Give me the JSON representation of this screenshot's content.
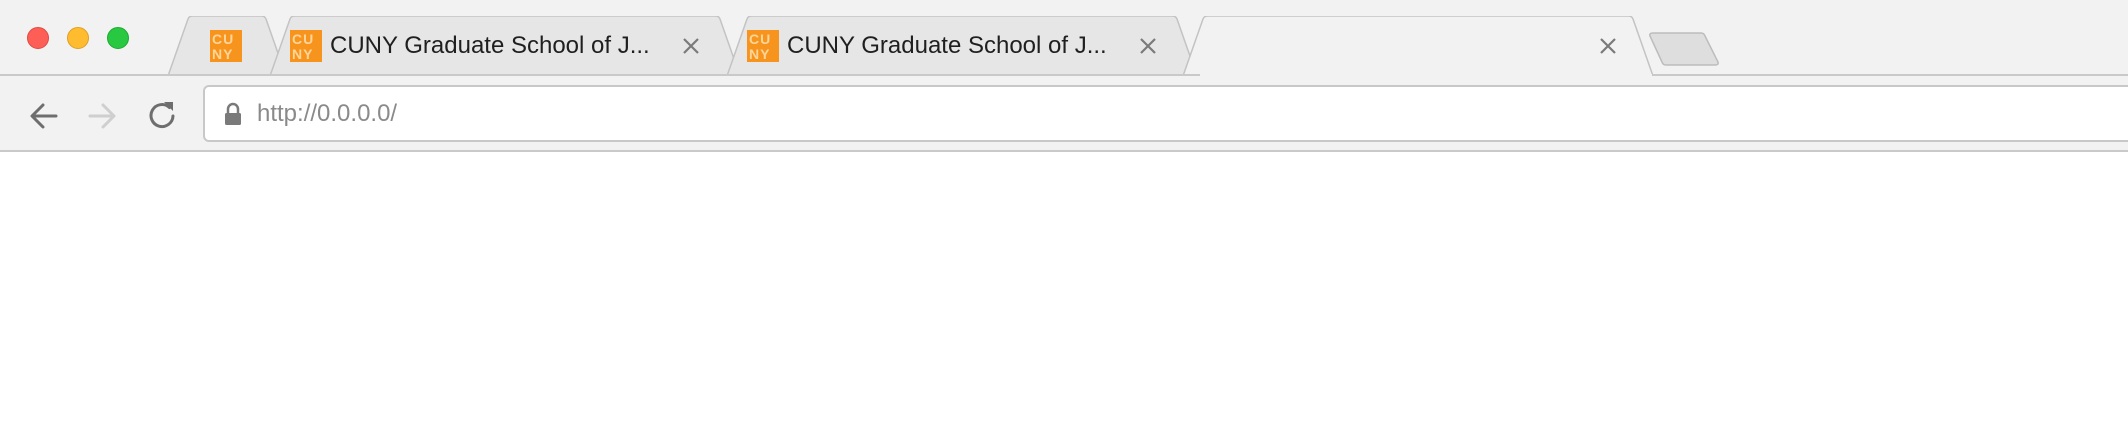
{
  "window": {
    "controls": [
      "close",
      "minimize",
      "maximize"
    ]
  },
  "tabs": [
    {
      "favicon": "cuny-logo",
      "favicon_text": "CUNY",
      "title": "",
      "pinned": true,
      "active": false
    },
    {
      "favicon": "cuny-logo",
      "favicon_text": "CUNY",
      "title": "CUNY Graduate School of J...",
      "active": false
    },
    {
      "favicon": "cuny-logo",
      "favicon_text": "CUNY",
      "title": "CUNY Graduate School of J...",
      "active": false
    },
    {
      "favicon": "",
      "title": "",
      "active": true
    }
  ],
  "toolbar": {
    "back_icon": "arrow-left-icon",
    "forward_icon": "arrow-right-icon",
    "reload_icon": "reload-icon",
    "omnibox": {
      "lock_icon": "lock-icon",
      "url": "http://0.0.0.0/"
    }
  },
  "colors": {
    "chrome_bg": "#f2f2f2",
    "favicon_orange": "#f7941d",
    "close_red": "#fd5f57",
    "min_yellow": "#febc2e",
    "max_green": "#28c840"
  }
}
